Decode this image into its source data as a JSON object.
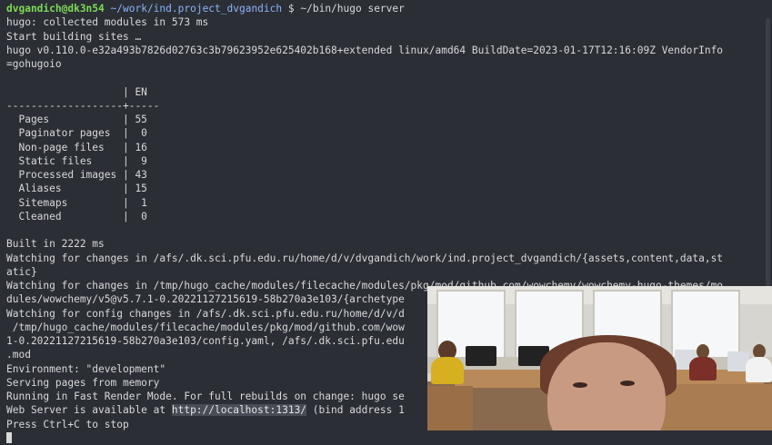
{
  "terminal": {
    "prompt": {
      "user": "dvgandich@dk3n54",
      "path": "~/work/ind.project_dvgandich",
      "symbol": "$",
      "command": "~/bin/hugo server"
    },
    "lines_before_table": [
      "hugo: collected modules in 573 ms",
      "Start building sites …",
      "hugo v0.110.0-e32a493b7826d02763c3b79623952e625402b168+extended linux/amd64 BuildDate=2023-01-17T12:16:09Z VendorInfo",
      "=gohugoio",
      ""
    ],
    "table": {
      "header": "                   | EN",
      "separator": "-------------------+-----",
      "rows": [
        "  Pages            | 55",
        "  Paginator pages  |  0",
        "  Non-page files   | 16",
        "  Static files     |  9",
        "  Processed images | 43",
        "  Aliases          | 15",
        "  Sitemaps         |  1",
        "  Cleaned          |  0"
      ]
    },
    "lines_after_table": [
      "",
      "Built in 2222 ms",
      "Watching for changes in /afs/.dk.sci.pfu.edu.ru/home/d/v/dvgandich/work/ind.project_dvgandich/{assets,content,data,st",
      "atic}",
      "Watching for changes in /tmp/hugo_cache/modules/filecache/modules/pkg/mod/github.com/wowchemy/wowchemy-hugo-themes/mo",
      "dules/wowchemy/v5@v5.7.1-0.20221127215619-58b270a3e103/{archetype",
      "Watching for config changes in /afs/.dk.sci.pfu.edu.ru/home/d/v/d",
      " /tmp/hugo_cache/modules/filecache/modules/pkg/mod/github.com/wow",
      "1-0.20221127215619-58b270a3e103/config.yaml, /afs/.dk.sci.pfu.edu",
      ".mod",
      "Environment: \"development\"",
      "Serving pages from memory",
      "Running in Fast Render Mode. For full rebuilds on change: hugo se"
    ],
    "server_line": {
      "prefix": "Web Server is available at ",
      "url": "http://localhost:1313/",
      "suffix": " (bind address 1"
    },
    "stop_hint": "Press Ctrl+C to stop"
  },
  "webcam": {
    "icon": "webcam-video-feed"
  }
}
